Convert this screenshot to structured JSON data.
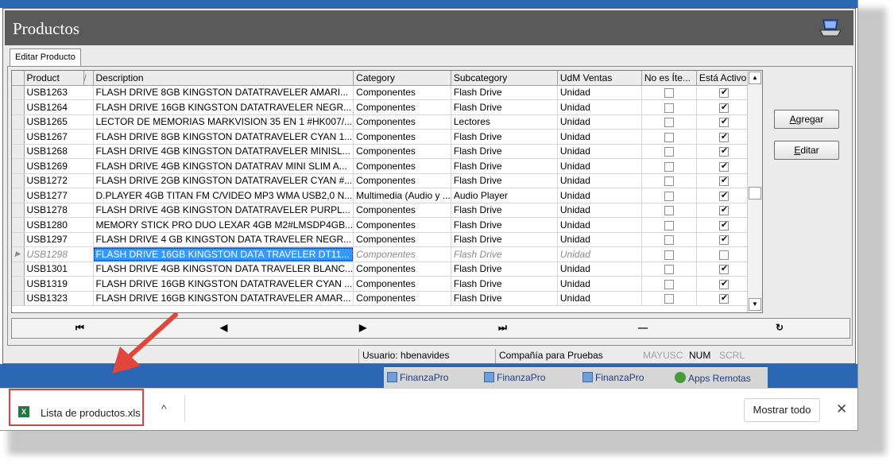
{
  "window": {
    "title": "Productos"
  },
  "tabs": [
    {
      "label": "Editar Producto"
    }
  ],
  "grid": {
    "columns": [
      "Product",
      "/",
      "Description",
      "Category",
      "Subcategory",
      "UdM Ventas",
      "No es Íte...",
      "Está Activo"
    ],
    "rows": [
      {
        "product": "USB1263",
        "description": "FLASH DRIVE 8GB KINGSTON DATATRAVELER AMARI...",
        "category": "Componentes",
        "subcategory": "Flash Drive",
        "udm": "Unidad",
        "no_item": false,
        "active": true
      },
      {
        "product": "USB1264",
        "description": "FLASH DRIVE 16GB KINGSTON DATATRAVELER NEGR...",
        "category": "Componentes",
        "subcategory": "Flash Drive",
        "udm": "Unidad",
        "no_item": false,
        "active": true
      },
      {
        "product": "USB1265",
        "description": "LECTOR DE MEMORIAS MARKVISION 35 EN 1 #HK007/...",
        "category": "Componentes",
        "subcategory": "Lectores",
        "udm": "Unidad",
        "no_item": false,
        "active": true
      },
      {
        "product": "USB1267",
        "description": "FLASH DRIVE 8GB KINGSTON DATATRAVELER CYAN 1...",
        "category": "Componentes",
        "subcategory": "Flash Drive",
        "udm": "Unidad",
        "no_item": false,
        "active": true
      },
      {
        "product": "USB1268",
        "description": "FLASH DRIVE 4GB KINGSTON DATATRAVELER MINISL...",
        "category": "Componentes",
        "subcategory": "Flash Drive",
        "udm": "Unidad",
        "no_item": false,
        "active": true
      },
      {
        "product": "USB1269",
        "description": "FLASH DRIVE 4GB KINGSTON DATATRAV MINI SLIM A...",
        "category": "Componentes",
        "subcategory": "Flash Drive",
        "udm": "Unidad",
        "no_item": false,
        "active": true
      },
      {
        "product": "USB1272",
        "description": "FLASH DRIVE 2GB KINGSTON DATATRAVELER CYAN #...",
        "category": "Componentes",
        "subcategory": "Flash Drive",
        "udm": "Unidad",
        "no_item": false,
        "active": true
      },
      {
        "product": "USB1277",
        "description": "D.PLAYER 4GB TITAN FM C/VIDEO MP3 WMA USB2,0 N...",
        "category": "Multimedia (Audio y ...",
        "subcategory": "Audio Player",
        "udm": "Unidad",
        "no_item": false,
        "active": true
      },
      {
        "product": "USB1278",
        "description": "FLASH DRIVE 4GB KINGSTON DATATRAVELER PURPL...",
        "category": "Componentes",
        "subcategory": "Flash Drive",
        "udm": "Unidad",
        "no_item": false,
        "active": true
      },
      {
        "product": "USB1280",
        "description": "MEMORY STICK PRO DUO LEXAR 4GB M2#LMSDP4GB...",
        "category": "Componentes",
        "subcategory": "Flash Drive",
        "udm": "Unidad",
        "no_item": false,
        "active": true
      },
      {
        "product": "USB1297",
        "description": "FLASH DRIVE 4 GB KINGSTON DATA TRAVELER NEGR...",
        "category": "Componentes",
        "subcategory": "Flash Drive",
        "udm": "Unidad",
        "no_item": false,
        "active": true
      },
      {
        "product": "USB1298",
        "description": "FLASH DRIVE 16GB KINGSTON DATA TRAVELER DT11...",
        "category": "Componentes",
        "subcategory": "Flash Drive",
        "udm": "Unidad",
        "no_item": false,
        "active": false,
        "current": true
      },
      {
        "product": "USB1301",
        "description": "FLASH DRIVE 4GB KINGSTON DATA TRAVELER BLANC...",
        "category": "Componentes",
        "subcategory": "Flash Drive",
        "udm": "Unidad",
        "no_item": false,
        "active": true
      },
      {
        "product": "USB1319",
        "description": "FLASH DRIVE 16GB KINGSTON DATATRAVELER CYAN ...",
        "category": "Componentes",
        "subcategory": "Flash Drive",
        "udm": "Unidad",
        "no_item": false,
        "active": true
      },
      {
        "product": "USB1323",
        "description": "FLASH DRIVE 16GB KINGSTON DATATRAVELER AMAR...",
        "category": "Componentes",
        "subcategory": "Flash Drive",
        "udm": "Unidad",
        "no_item": false,
        "active": true
      }
    ]
  },
  "buttons": {
    "agregar": {
      "first": "A",
      "rest": "gregar"
    },
    "editar": {
      "first": "E",
      "rest": "ditar"
    }
  },
  "nav": {
    "first": "⏮",
    "prev": "◀",
    "next": "▶",
    "last": "⏭",
    "minus": "—",
    "refresh": "↻"
  },
  "status": {
    "usuario": "Usuario: hbenavides",
    "compania": "Compañía para Pruebas",
    "mayusc": "MAYUSC",
    "num": "NUM",
    "scrl": "SCRL"
  },
  "taskbar": [
    {
      "label": "FinanzaPro",
      "icon": "app-icon"
    },
    {
      "label": "FinanzaPro",
      "icon": "app-icon"
    },
    {
      "label": "FinanzaPro",
      "icon": "app-icon"
    },
    {
      "label": "Apps Remotas",
      "icon": "globe-icon"
    }
  ],
  "download": {
    "file_name": "Lista de productos.xls",
    "file_icon": "excel-icon",
    "show_all": "Mostrar todo",
    "close": "✕",
    "chevron": "^"
  },
  "colors": {
    "title_band": "#595a59",
    "taskbar": "#2c67b3",
    "selection": "#3399ff",
    "highlight_box": "#e04040"
  }
}
